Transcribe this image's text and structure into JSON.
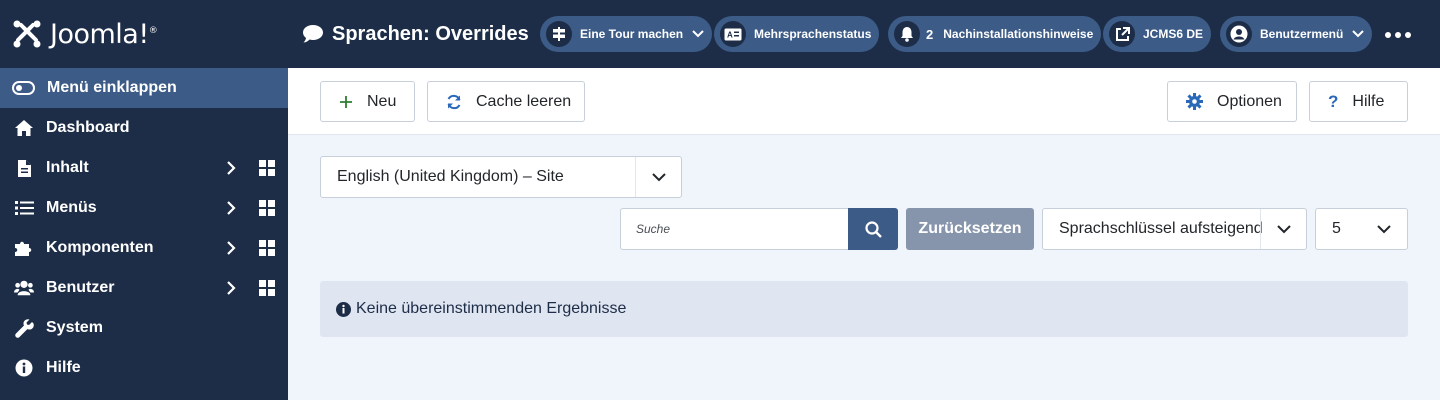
{
  "brand": {
    "name": "Joomla!",
    "trademark": "®",
    "logo_icon": "joomla-logo-icon"
  },
  "sidebar": {
    "collapse_label": "Menü einklappen",
    "items": [
      {
        "label": "Dashboard",
        "icon": "home-icon",
        "has_submenu": false
      },
      {
        "label": "Inhalt",
        "icon": "file-icon",
        "has_submenu": true
      },
      {
        "label": "Menüs",
        "icon": "list-icon",
        "has_submenu": true
      },
      {
        "label": "Komponenten",
        "icon": "puzzle-icon",
        "has_submenu": true
      },
      {
        "label": "Benutzer",
        "icon": "users-icon",
        "has_submenu": true
      },
      {
        "label": "System",
        "icon": "wrench-icon",
        "has_submenu": false
      },
      {
        "label": "Hilfe",
        "icon": "info-icon",
        "has_submenu": false
      }
    ]
  },
  "header": {
    "title": "Sprachen: Overrides",
    "title_icon": "comment-icon",
    "pills": {
      "tour": "Eine Tour machen",
      "multilang": "Mehrsprachenstatus",
      "notifications_count": "2",
      "notifications": "Nachinstallationshinweise",
      "site": "JCMS6 DE",
      "user_menu": "Benutzermenü"
    }
  },
  "toolbar": {
    "new_label": "Neu",
    "clear_cache_label": "Cache leeren",
    "options_label": "Optionen",
    "help_label": "Hilfe"
  },
  "filters": {
    "language_select": "English (United Kingdom) – Site",
    "search_placeholder": "Suche",
    "reset_label": "Zurücksetzen",
    "sort_select": "Sprachschlüssel aufsteigend",
    "limit_select": "5"
  },
  "alert": {
    "message": "Keine übereinstimmenden Ergebnisse"
  },
  "colors": {
    "sidebar_bg": "#1d2d47",
    "active_bg": "#3c5b87",
    "page_bg": "#f0f4fb",
    "reset_bg": "#8695ab",
    "alert_bg": "#dfe5f1"
  }
}
